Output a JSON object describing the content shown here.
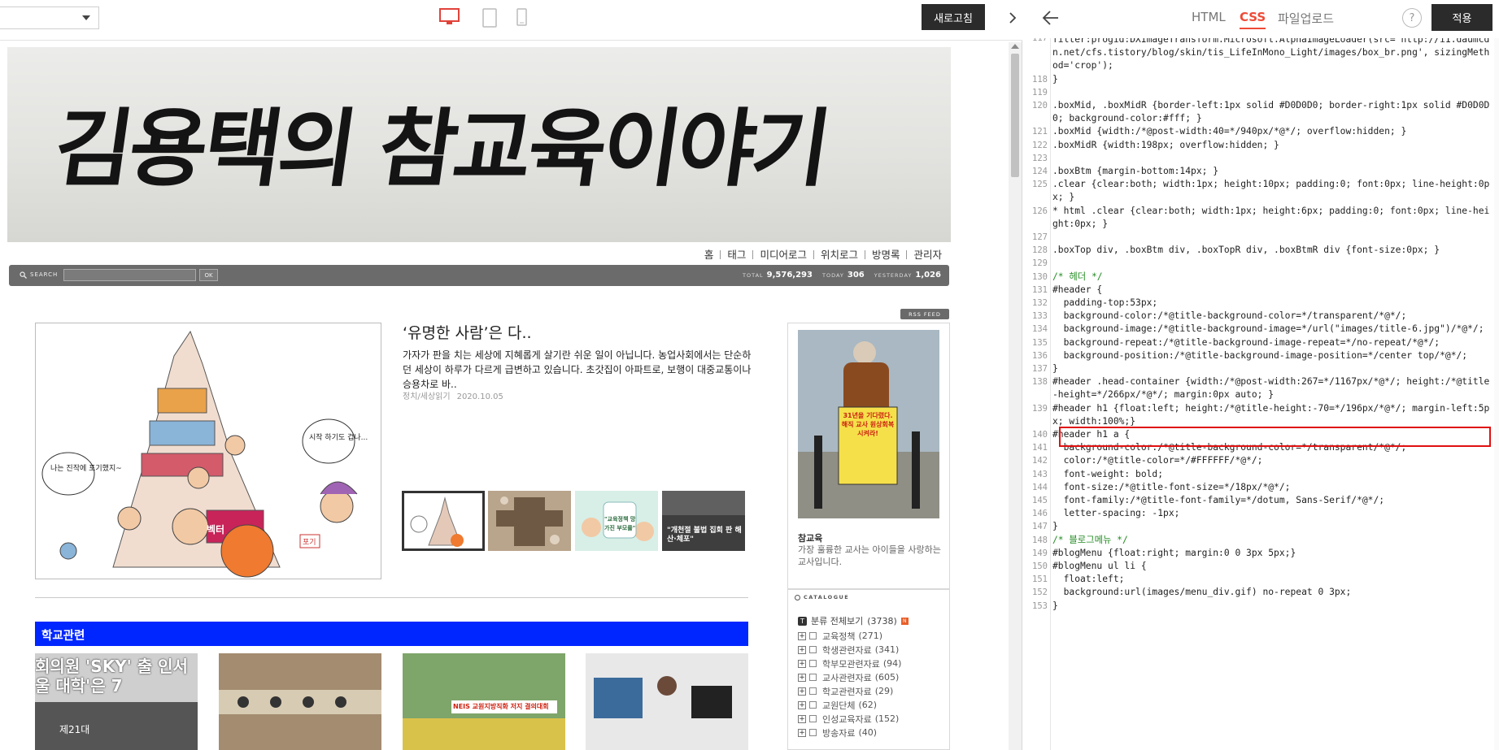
{
  "preview": {
    "refresh_label": "새로고침",
    "blog_title": "김용택의 참교육이야기",
    "menu": [
      "홈",
      "태그",
      "미디어로그",
      "위치로그",
      "방명록",
      "관리자"
    ],
    "search": {
      "label": "SEARCH",
      "ok": "OK"
    },
    "stats": [
      {
        "key": "TOTAL",
        "value": "9,576,293"
      },
      {
        "key": "TODAY",
        "value": "306"
      },
      {
        "key": "YESTERDAY",
        "value": "1,026"
      }
    ],
    "rss_label": "RSS FEED",
    "featured": {
      "title": "‘유명한 사람’은 다..",
      "excerpt": "가자가 판을 치는 세상에 지혜롭게 살기란 쉬운 일이 아닙니다. 농업사회에서는 단순하던 세상이 하루가 다르게 급변하고 있습니다. 초갓집이 아파트로, 보행이 대중교통이나 승용차로 바..",
      "category": "정치/세상읽기",
      "date": "2020.10.05",
      "image_texts": [
        "나는 진작에 포기했지~",
        "시작 하기도 겁나...",
        "벡터",
        "포기"
      ],
      "thumb_captions": [
        "",
        "",
        "\"교육정책 망가진 부모를\"",
        "\"개천절 불법 집회 판 해산·체포\""
      ]
    },
    "category_section": {
      "title": "학교관련",
      "thumb_1_text": "회의원 'SKY' 출 인서울 대학'은 7",
      "thumb_1_sub": "제21대",
      "thumb_3_text": "NEIS 교원지방직화 저지 결의대회"
    },
    "profile": {
      "name": "참교육",
      "desc": "가장 훌륭한 교사는 아이들을 사랑하는 교사입니다.",
      "sign_text": "31년을 기다렸다. 해직 교사 원상회복 시켜라!"
    },
    "catalogue": {
      "heading": "CATALOGUE",
      "all_label": "분류 전체보기",
      "all_count": "(3738)",
      "items": [
        {
          "label": "교육정책",
          "count": "(271)"
        },
        {
          "label": "학생관련자료",
          "count": "(341)"
        },
        {
          "label": "학부모관련자료",
          "count": "(94)"
        },
        {
          "label": "교사관련자료",
          "count": "(605)"
        },
        {
          "label": "학교관련자료",
          "count": "(29)"
        },
        {
          "label": "교원단체",
          "count": "(62)"
        },
        {
          "label": "인성교육자료",
          "count": "(152)"
        },
        {
          "label": "방송자료",
          "count": "(40)"
        }
      ]
    }
  },
  "editor": {
    "tabs": [
      "HTML",
      "CSS",
      "파일업로드"
    ],
    "active_tab": "CSS",
    "help_label": "?",
    "apply_label": "적용",
    "lines": [
      {
        "n": "117",
        "t": "filter:progid:DXImageTransform.Microsoft.AlphaImageLoader(src='http://i1.daumcdn.net/cfs.tistory/blog/skin/tis_LifeInMono_Light/images/box_br.png', sizingMethod='crop');"
      },
      {
        "n": "118",
        "t": "}"
      },
      {
        "n": "119",
        "t": ""
      },
      {
        "n": "120",
        "t": ".boxMid, .boxMidR {border-left:1px solid #D0D0D0; border-right:1px solid #D0D0D0; background-color:#fff; }"
      },
      {
        "n": "121",
        "t": ".boxMid {width:/*@post-width:40=*/940px/*@*/; overflow:hidden; }"
      },
      {
        "n": "122",
        "t": ".boxMidR {width:198px; overflow:hidden; }"
      },
      {
        "n": "123",
        "t": ""
      },
      {
        "n": "124",
        "t": ".boxBtm {margin-bottom:14px; }"
      },
      {
        "n": "125",
        "t": ".clear {clear:both; width:1px; height:10px; padding:0; font:0px; line-height:0px; }"
      },
      {
        "n": "126",
        "t": "* html .clear {clear:both; width:1px; height:6px; padding:0; font:0px; line-height:0px; }"
      },
      {
        "n": "127",
        "t": ""
      },
      {
        "n": "128",
        "t": ".boxTop div, .boxBtm div, .boxTopR div, .boxBtmR div {font-size:0px; }"
      },
      {
        "n": "129",
        "t": ""
      },
      {
        "n": "130",
        "t": "/* 헤더 */"
      },
      {
        "n": "131",
        "t": "#header {"
      },
      {
        "n": "132",
        "t": "  padding-top:53px;"
      },
      {
        "n": "133",
        "t": "  background-color:/*@title-background-color=*/transparent/*@*/;"
      },
      {
        "n": "134",
        "t": "  background-image:/*@title-background-image=*/url(\"images/title-6.jpg\")/*@*/;"
      },
      {
        "n": "135",
        "t": "  background-repeat:/*@title-background-image-repeat=*/no-repeat/*@*/;"
      },
      {
        "n": "136",
        "t": "  background-position:/*@title-background-image-position=*/center top/*@*/;"
      },
      {
        "n": "137",
        "t": "}"
      },
      {
        "n": "138",
        "t": "#header .head-container {width:/*@post-width:267=*/1167px/*@*/; height:/*@title-height=*/266px/*@*/; margin:0px auto; }"
      },
      {
        "n": "139",
        "t": "#header h1 {float:left; height:/*@title-height:-70=*/196px/*@*/; margin-left:5px; width:100%;}"
      },
      {
        "n": "140",
        "t": "#header h1 a {"
      },
      {
        "n": "141",
        "t": "  background-color:/*@title-background-color=*/transparent/*@*/;"
      },
      {
        "n": "142",
        "t": "  color:/*@title-color=*/#FFFFFF/*@*/;"
      },
      {
        "n": "143",
        "t": "  font-weight: bold;"
      },
      {
        "n": "144",
        "t": "  font-size:/*@title-font-size=*/18px/*@*/;"
      },
      {
        "n": "145",
        "t": "  font-family:/*@title-font-family=*/dotum, Sans-Serif/*@*/;"
      },
      {
        "n": "146",
        "t": "  letter-spacing: -1px;"
      },
      {
        "n": "147",
        "t": "}"
      },
      {
        "n": "148",
        "t": "/* 블로그메뉴 */"
      },
      {
        "n": "149",
        "t": "#blogMenu {float:right; margin:0 0 3px 5px;}"
      },
      {
        "n": "150",
        "t": "#blogMenu ul li {"
      },
      {
        "n": "151",
        "t": "  float:left;"
      },
      {
        "n": "152",
        "t": "  background:url(images/menu_div.gif) no-repeat 0 3px;"
      },
      {
        "n": "153",
        "t": "}"
      }
    ]
  },
  "colors": {
    "accent": "#ee4b37",
    "category_bar": "#0026ff",
    "dark_button": "#2b2b2b",
    "highlight_box": "#e01010"
  }
}
